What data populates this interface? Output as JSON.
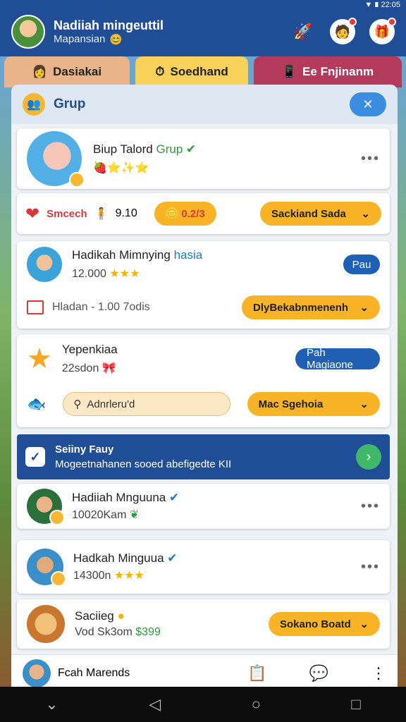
{
  "status": {
    "time": "22:05"
  },
  "header": {
    "name": "Nadiiah mingeuttil",
    "subtitle": "Mapansian"
  },
  "tabs": [
    {
      "label": "Dasiakai"
    },
    {
      "label": "Soedhand"
    },
    {
      "label": "Ee Fnjinanm"
    }
  ],
  "panel": {
    "title": "Grup"
  },
  "group_card": {
    "title_prefix": "Biup Talord",
    "title_suffix": "Grup"
  },
  "stats": {
    "label": "Smcech",
    "value": "9.10",
    "coins": "0.2/3",
    "dropdown": "Sackiand Sada"
  },
  "card1": {
    "title": "Hadikah Mimnying",
    "title_tag": "hasia",
    "sub": "12.000",
    "button": "Pau",
    "meta": "Hladan - 1.00 7odis",
    "dropdown": "DlyBekabnmenenh"
  },
  "card2": {
    "title": "Yepenkiaa",
    "sub": "22sdon",
    "button": "Pah Magiaone",
    "input": "Adnrleru'd",
    "dropdown": "Mac Sgehoia"
  },
  "banner": {
    "title": "Seiiny Fauy",
    "text": "Mogeetnahanen sooed abefigedte KII"
  },
  "list": [
    {
      "name": "Hadiiah Mnguuna",
      "sub": "10020Kam"
    },
    {
      "name": "Hadkah Minguua",
      "sub": "14300n"
    },
    {
      "name": "Saciieg",
      "sub": "Vod Sk3om",
      "amount": "$399",
      "dropdown": "Sokano Boatd"
    }
  ],
  "bottom": {
    "label": "Fcah Marends"
  }
}
